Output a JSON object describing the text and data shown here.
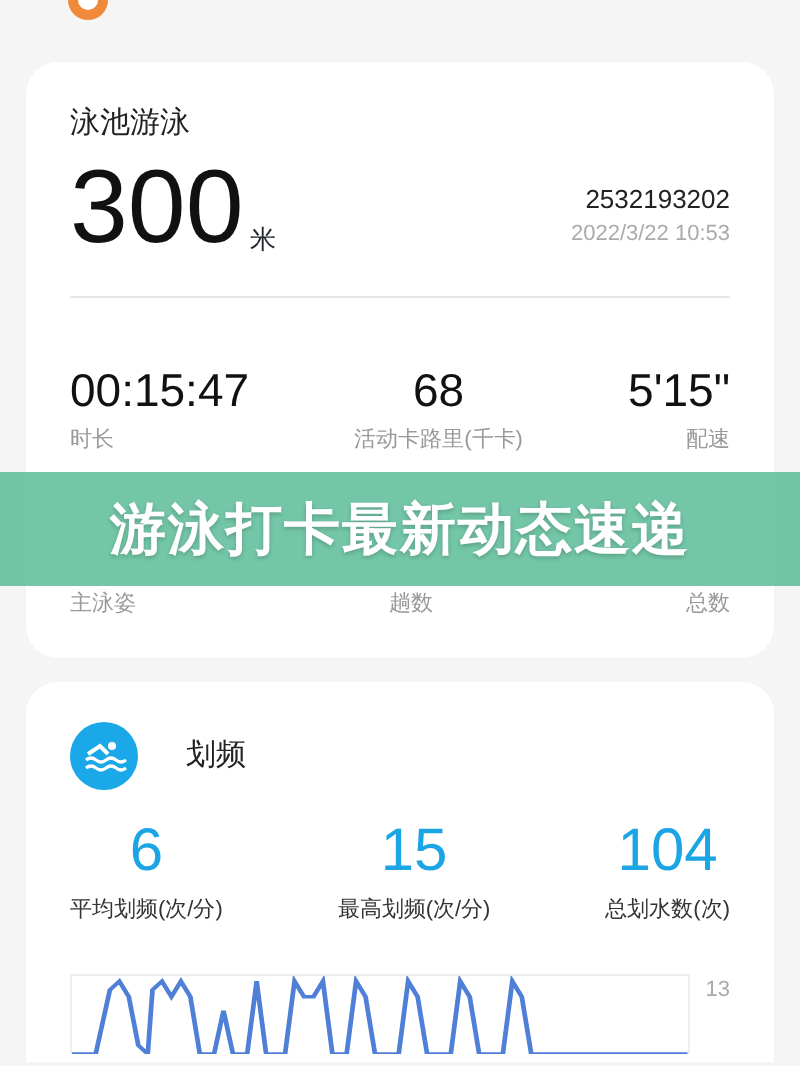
{
  "summary": {
    "title": "泳池游泳",
    "distance": "300",
    "unit": "米",
    "device_id": "2532193202",
    "datetime": "2022/3/22 10:53",
    "stats": [
      {
        "value": "00:15:47",
        "label": "时长"
      },
      {
        "value": "68",
        "label": "活动卡路里(千卡)"
      },
      {
        "value": "5'15\"",
        "label": "配速"
      }
    ],
    "stats_hidden_row": [
      {
        "label": "主泳姿"
      },
      {
        "label": "趟数"
      },
      {
        "label": "总数"
      }
    ]
  },
  "banner": {
    "text": "游泳打卡最新动态速递"
  },
  "stroke": {
    "title": "划频",
    "stats": [
      {
        "value": "6",
        "label": "平均划频(次/分)"
      },
      {
        "value": "15",
        "label": "最高划频(次/分)"
      },
      {
        "value": "104",
        "label": "总划水数(次)"
      }
    ],
    "axis_label": "13"
  }
}
